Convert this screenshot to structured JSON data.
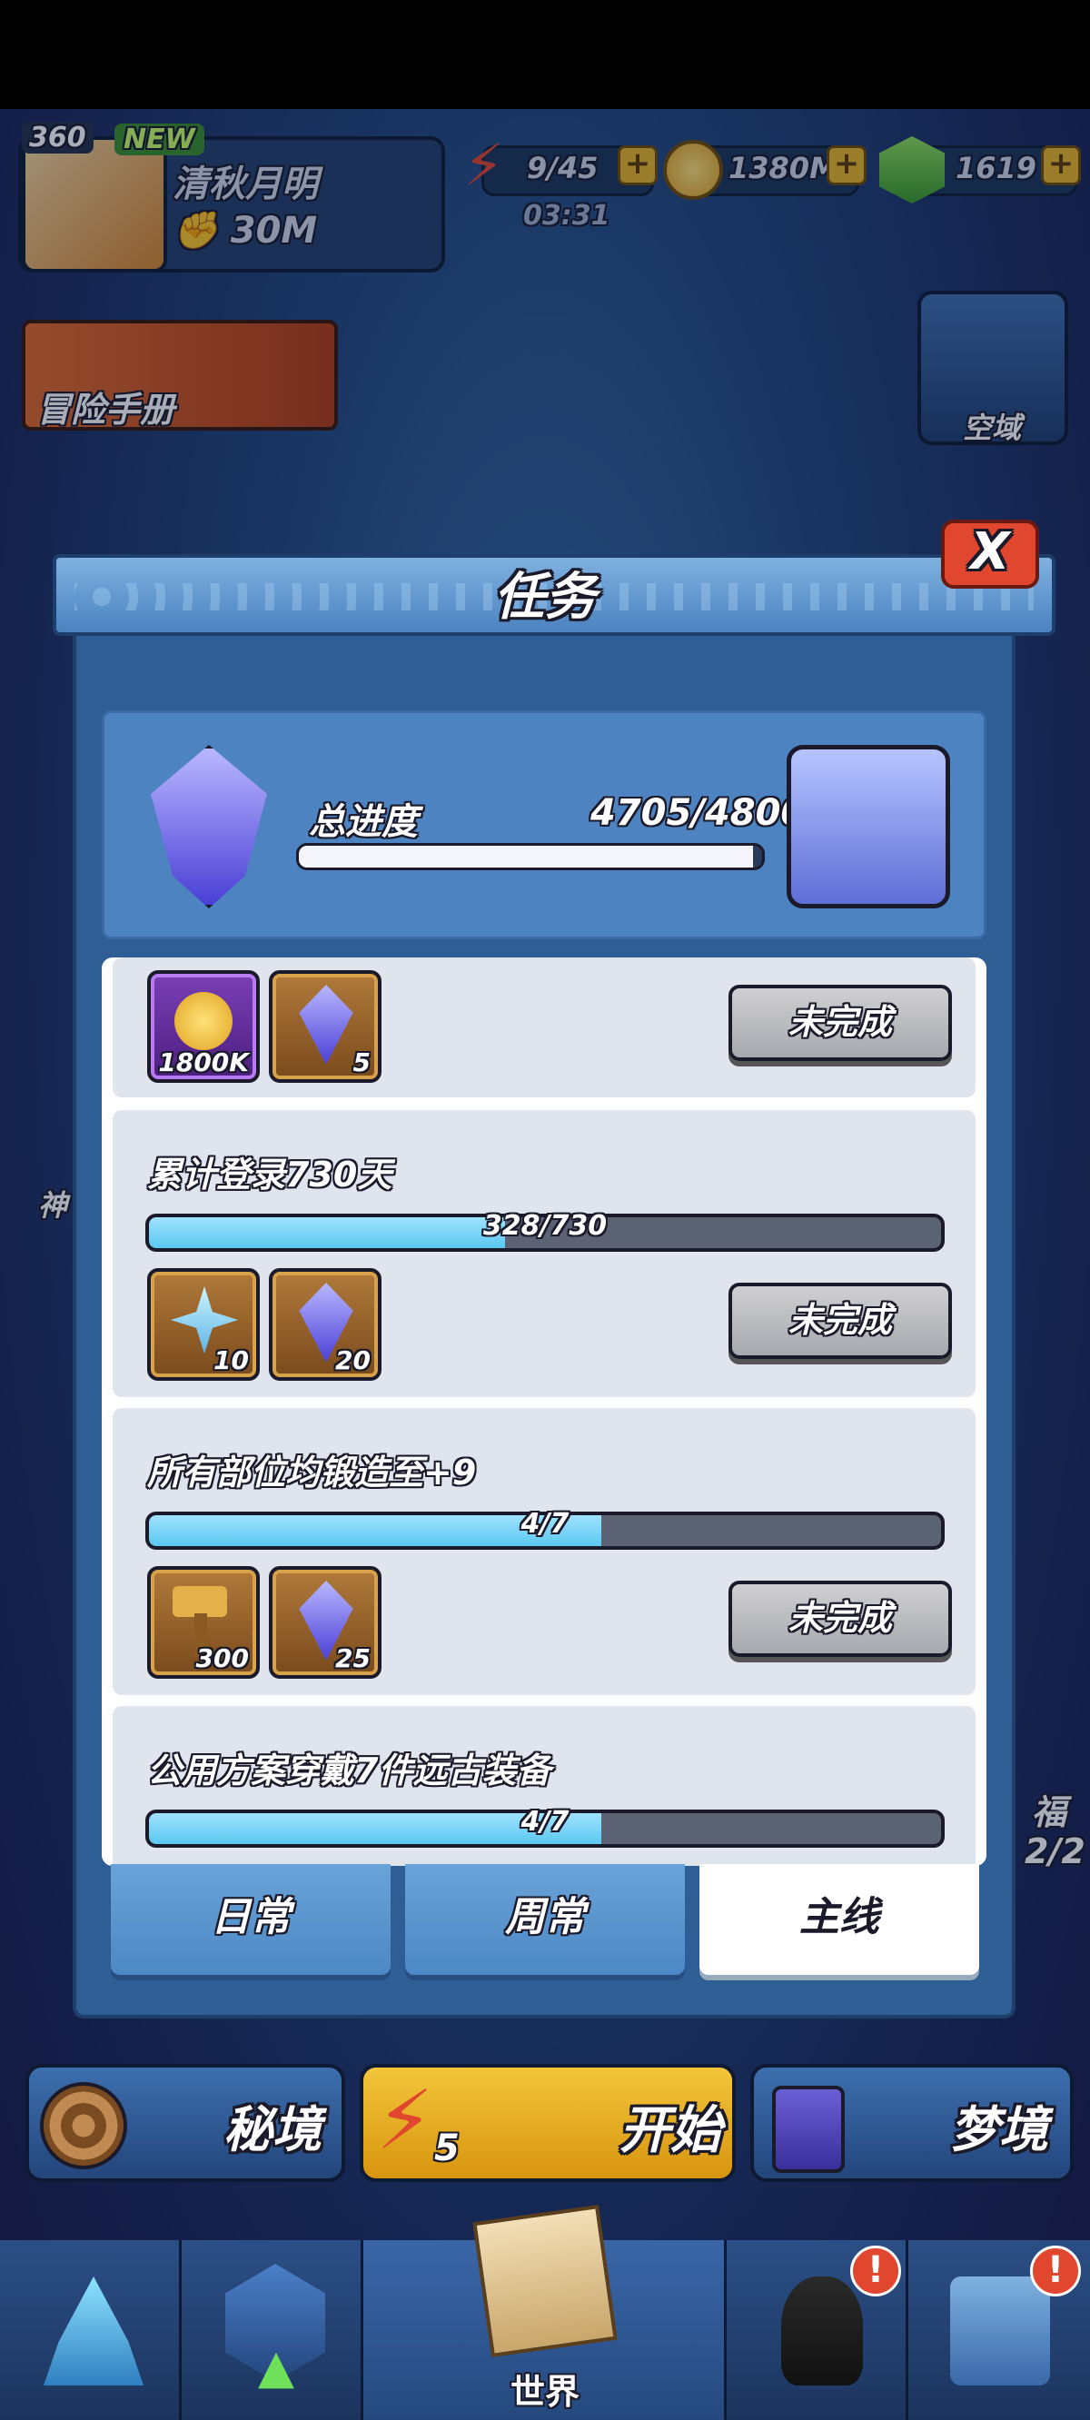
{
  "player": {
    "level": "360",
    "new_badge": "NEW",
    "name": "清秋月明",
    "power": "30M"
  },
  "resources": {
    "energy": "9/45",
    "energy_timer": "03:31",
    "gold": "1380M",
    "gems": "1619",
    "plus": "+"
  },
  "side": {
    "adventure_manual": "冒险手册",
    "airspace": "空域",
    "left_partial": "神",
    "right_partial_1": "福",
    "right_partial_2": "2/2"
  },
  "modal": {
    "title": "任务",
    "close": "X",
    "summary": {
      "label": "总进度",
      "progress_text": "4705/4800",
      "progress": 0.98
    },
    "tasks": [
      {
        "title": "",
        "rewards": [
          {
            "icon": "gold-coins-icon",
            "qty": "1800K"
          },
          {
            "icon": "crystal-emblem-icon",
            "qty": "5"
          }
        ],
        "status": "未完成"
      },
      {
        "title": "累计登录730天",
        "progress_text": "328/730",
        "progress": 0.449,
        "rewards": [
          {
            "icon": "star-crystal-icon",
            "qty": "10"
          },
          {
            "icon": "crystal-emblem-icon",
            "qty": "20"
          }
        ],
        "status": "未完成"
      },
      {
        "title": "所有部位均锻造至+9",
        "progress_text": "4/7",
        "progress": 0.571,
        "rewards": [
          {
            "icon": "forge-hammer-icon",
            "qty": "300"
          },
          {
            "icon": "crystal-emblem-icon",
            "qty": "25"
          }
        ],
        "status": "未完成"
      },
      {
        "title": "公用方案穿戴7件远古装备",
        "progress_text": "4/7",
        "progress": 0.571
      }
    ],
    "tabs": [
      "日常",
      "周常",
      "主线"
    ]
  },
  "bottom_buttons": {
    "secret": "秘境",
    "start": "开始",
    "start_cost": "5",
    "dream": "梦境"
  },
  "nav": {
    "world": "世界"
  },
  "colors": {
    "modal_blue": "#2f5e95",
    "progress_cyan": "#5ac7ef",
    "close_red": "#e0472e",
    "gold": "#e9b728"
  }
}
